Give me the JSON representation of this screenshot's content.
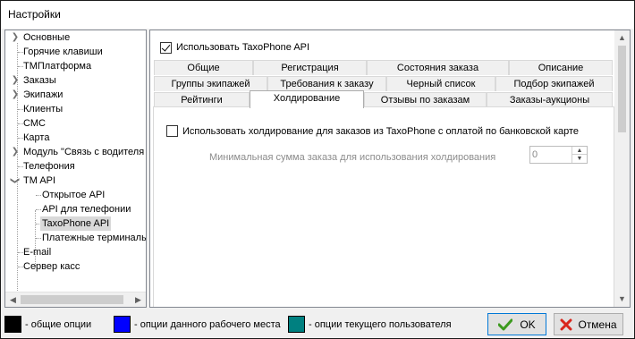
{
  "window": {
    "title": "Настройки"
  },
  "tree": {
    "items": [
      {
        "label": "Основные",
        "expander": true
      },
      {
        "label": "Горячие клавиши",
        "expander": false
      },
      {
        "label": "ТМПлатформа",
        "expander": false
      },
      {
        "label": "Заказы",
        "expander": true
      },
      {
        "label": "Экипажи",
        "expander": true
      },
      {
        "label": "Клиенты",
        "expander": false
      },
      {
        "label": "СМС",
        "expander": false
      },
      {
        "label": "Карта",
        "expander": false
      },
      {
        "label": "Модуль \"Связь с водителя",
        "expander": true
      },
      {
        "label": "Телефония",
        "expander": false
      },
      {
        "label": "TM API",
        "expander": true,
        "expanded": true
      },
      {
        "label": "Открытое API",
        "child": true
      },
      {
        "label": "API для телефонии",
        "child": true
      },
      {
        "label": "TaxoPhone API",
        "child": true,
        "selected": true
      },
      {
        "label": "Платежные терминалы",
        "child": true
      },
      {
        "label": "E-mail",
        "expander": false
      },
      {
        "label": "Сервер касс",
        "expander": false
      }
    ]
  },
  "content": {
    "use_api_label": "Использовать TaxoPhone API",
    "use_api_checked": true,
    "tabs_row1": [
      "Общие",
      "Регистрация",
      "Состояния заказа",
      "Описание"
    ],
    "tabs_row2": [
      "Группы экипажей",
      "Требования к заказу",
      "Черный список",
      "Подбор экипажей"
    ],
    "tabs_row3": [
      "Рейтинги",
      "Холдирование",
      "Отзывы по заказам",
      "Заказы-аукционы"
    ],
    "active_tab": "Холдирование",
    "hold_label": "Использовать холдирование для заказов из TaxoPhone с оплатой по банковской карте",
    "hold_checked": false,
    "min_sum_label": "Минимальная сумма заказа для использования холдирования",
    "min_sum_value": "0"
  },
  "legend": [
    {
      "label": "- общие опции",
      "color": "#000000"
    },
    {
      "label": "- опции данного рабочего места",
      "color": "#0000ff"
    },
    {
      "label": "- опции текущего пользователя",
      "color": "#008080"
    }
  ],
  "buttons": {
    "ok_label": "OK",
    "cancel_label": "Отмена",
    "ok_icon": "checkmark-icon",
    "cancel_icon": "cross-icon"
  }
}
